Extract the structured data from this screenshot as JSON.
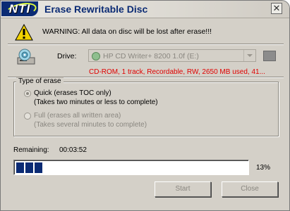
{
  "window": {
    "logo": "NTI",
    "title": "Erase Rewritable Disc",
    "close_symbol": "✕"
  },
  "warning": {
    "icon": "warning-icon",
    "text": "WARNING: All data on disc will be lost after erase!!!"
  },
  "drive": {
    "icon": "cd-drive-icon",
    "label": "Drive:",
    "selected": "HP CD Writer+ 8200 1.0f (E:)",
    "info": "CD-ROM, 1 track, Recordable, RW, 2650 MB used, 41..."
  },
  "erase_type": {
    "legend": "Type of erase",
    "options": [
      {
        "label": "Quick (erases TOC only)",
        "detail": "(Takes two minutes or less to complete)",
        "selected": true,
        "enabled": true
      },
      {
        "label": "Full (erases all written area)",
        "detail": "(Takes several minutes to complete)",
        "selected": false,
        "enabled": false
      }
    ]
  },
  "status": {
    "remaining_label": "Remaining:",
    "remaining_value": "00:03:52",
    "progress_percent": 13,
    "progress_text": "13%"
  },
  "buttons": {
    "start": "Start",
    "close": "Close"
  },
  "colors": {
    "accent": "#0b2b74",
    "warning_text": "#e00000"
  }
}
